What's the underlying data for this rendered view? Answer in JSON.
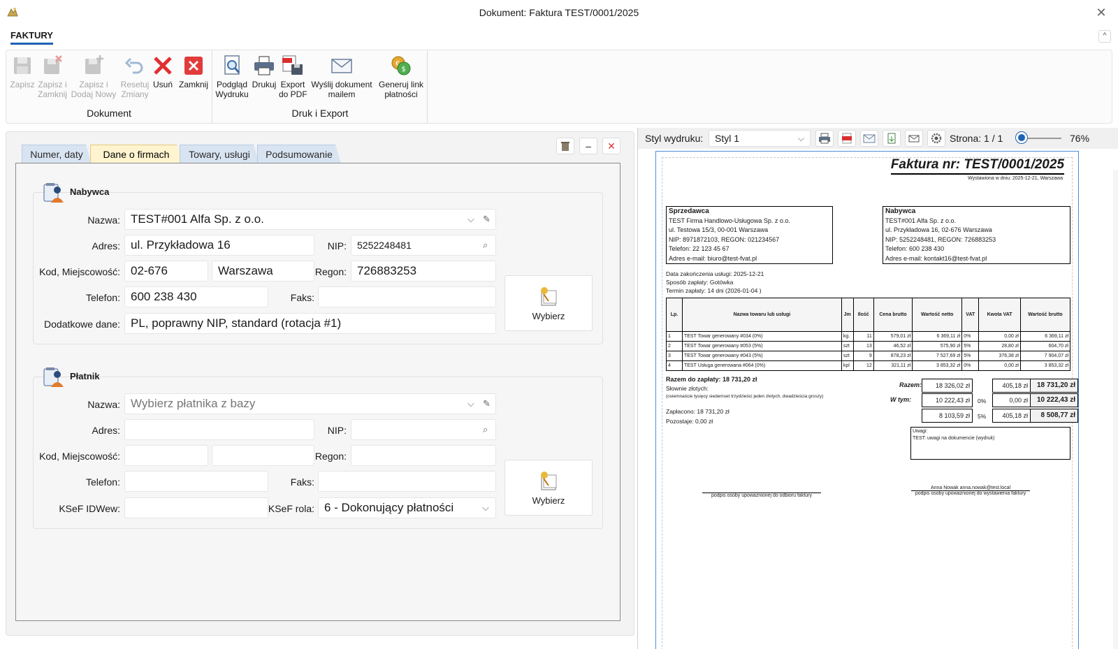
{
  "window": {
    "title": "Dokument: Faktura TEST/0001/2025",
    "close_glyph": "✕"
  },
  "ribbon": {
    "tab": "FAKTURY",
    "collapse_glyph": "^",
    "groups": [
      {
        "label": "Dokument"
      },
      {
        "label": "Druk i Export"
      }
    ],
    "buttons": {
      "save": "Zapisz",
      "save_close": "Zapisz i\nZamknij",
      "save_new": "Zapisz i\nDodaj Nowy",
      "reset": "Resetuj\nZmiany",
      "delete": "Usuń",
      "close": "Zamknij",
      "preview": "Podgląd\nWydruku",
      "print": "Drukuj",
      "export_pdf": "Export\ndo PDF",
      "send_mail": "Wyślij dokument\nmailem",
      "pay_link": "Generuj link\npłatności"
    }
  },
  "tabs": [
    "Numer, daty",
    "Dane o firmach",
    "Towary, usługi",
    "Podsumowanie"
  ],
  "nabywca": {
    "title": "Nabywca",
    "labels": {
      "nazwa": "Nazwa:",
      "adres": "Adres:",
      "nip": "NIP:",
      "kod": "Kod, Miejscowość:",
      "regon": "Regon:",
      "telefon": "Telefon:",
      "faks": "Faks:",
      "dodatkowe": "Dodatkowe dane:"
    },
    "nazwa": "TEST#001 Alfa Sp. z o.o.",
    "adres": "ul. Przykładowa 16",
    "nip": "5252248481",
    "kod": "02-676",
    "miejscowosc": "Warszawa",
    "regon": "726883253",
    "telefon": "600 238 430",
    "faks": "",
    "dodatkowe": "PL, poprawny NIP, standard (rotacja #1)",
    "pick_label": "Wybierz"
  },
  "platnik": {
    "title": "Płatnik",
    "labels": {
      "nazwa": "Nazwa:",
      "adres": "Adres:",
      "nip": "NIP:",
      "kod": "Kod, Miejscowość:",
      "regon": "Regon:",
      "telefon": "Telefon:",
      "faks": "Faks:",
      "ksef_id": "KSeF IDWew:",
      "ksef_rola": "KSeF rola:"
    },
    "nazwa_placeholder": "Wybierz płatnika z bazy",
    "ksef_rola": "6 - Dokonujący płatności",
    "pick_label": "Wybierz"
  },
  "print_toolbar": {
    "style_label": "Styl wydruku:",
    "style_value": "Styl 1",
    "page_label": "Strona: 1 / 1",
    "zoom_value": "76%"
  },
  "invoice": {
    "title": "Faktura nr: TEST/0001/2025",
    "issued": "Wystawiona w dniu: 2025-12-21, Warszawa",
    "seller": {
      "header": "Sprzedawca",
      "lines": [
        "TEST Firma Handlowo-Usługowa Sp. z o.o.",
        "ul. Testowa 15/3, 00-001 Warszawa",
        "NIP: 8971872103, REGON: 021234567",
        "Telefon: 22 123 45 67",
        "Adres e-mail: biuro@test-fvat.pl"
      ]
    },
    "buyer": {
      "header": "Nabywca",
      "lines": [
        "TEST#001 Alfa Sp. z o.o.",
        "ul. Przykładowa 16, 02-676 Warszawa",
        "NIP: 5252248481, REGON: 726883253",
        "Telefon: 600 238 430",
        "Adres e-mail: kontakt16@test-fvat.pl"
      ]
    },
    "meta": [
      "Data zakończenia usługi: 2025-12-21",
      "Sposób zapłaty: Gotówka",
      "Termin zapłaty: 14 dni (2026-01-04 )"
    ],
    "table_headers": [
      "Lp.",
      "Nazwa towaru lub usługi",
      "Jm",
      "Ilość",
      "Cena brutto",
      "Wartość netto",
      "VAT",
      "Kwota VAT",
      "Wartość brutto"
    ],
    "rows": [
      [
        "1",
        "TEST Towar generowany #034 (0%)",
        "kg.",
        "11",
        "579,01 zł",
        "6 369,11 zł",
        "0%",
        "0,00 zł",
        "6 369,11 zł"
      ],
      [
        "2",
        "TEST Towar generowany #053 (5%)",
        "szt",
        "13",
        "46,52 zł",
        "575,90 zł",
        "5%",
        "28,80 zł",
        "604,70 zł"
      ],
      [
        "3",
        "TEST Towar generowany #043 (5%)",
        "szt",
        "9",
        "878,23 zł",
        "7 527,69 zł",
        "5%",
        "376,38 zł",
        "7 904,07 zł"
      ],
      [
        "4",
        "TEST Usługa generowana #064 (0%)",
        "kpl",
        "12",
        "321,11 zł",
        "3 853,32 zł",
        "0%",
        "0,00 zł",
        "3 853,32 zł"
      ]
    ],
    "total_due": "Razem do zapłaty: 18 731,20 zł",
    "in_words_label": "Słownie złotych:",
    "in_words": "(osiemnaście tysięcy siedemset trzydzieści jeden złotych, dwadzieścia groszy)",
    "paid": "Zapłacono: 18 731,20 zł",
    "remaining": "Pozostaje: 0,00 zł",
    "summary": {
      "razem_label": "Razem:",
      "wtym_label": "W tym:",
      "razem": [
        "18 326,02 zł",
        "405,18 zł",
        "18 731,20 zł"
      ],
      "r0": [
        "10 222,43 zł",
        "0%",
        "0,00 zł",
        "10 222,43 zł"
      ],
      "r5": [
        "8 103,59 zł",
        "5%",
        "405,18 zł",
        "8 508,77 zł"
      ]
    },
    "notes_label": "Uwagi:",
    "notes": "TEST: uwagi na dokumencie (wydruk)",
    "sig_left": "podpis osoby upoważnionej do odbioru faktury",
    "sig_right_name": "Anna Nowak anna.nowak@test.local",
    "sig_right": "podpis osoby upoważnionej do wystawienia faktury"
  }
}
